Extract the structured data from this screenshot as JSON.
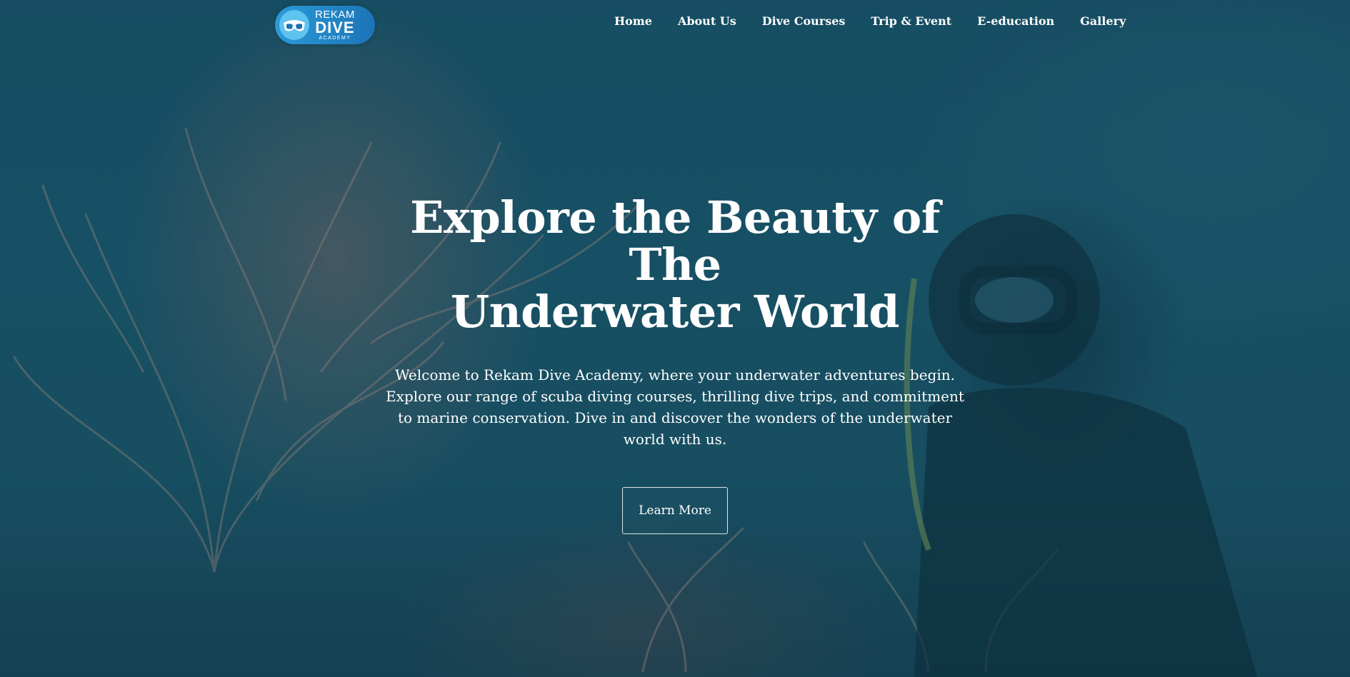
{
  "brand": {
    "line1": "REKAM",
    "line2": "DIVE",
    "line3": "ACADEMY",
    "badge_color": "#1c74b7"
  },
  "nav": {
    "items": [
      {
        "label": "Home"
      },
      {
        "label": "About Us"
      },
      {
        "label": "Dive Courses"
      },
      {
        "label": "Trip & Event"
      },
      {
        "label": "E-education"
      },
      {
        "label": "Gallery"
      }
    ]
  },
  "hero": {
    "headline_line1": "Explore the Beauty of The",
    "headline_line2": "Underwater World",
    "description": "Welcome to Rekam Dive Academy, where your underwater adventures begin. Explore our range of scuba diving courses, thrilling dive trips, and commitment to marine conservation. Dive in and discover the wonders of the underwater world with us.",
    "cta_label": "Learn More",
    "background_color": "#1a5268"
  }
}
